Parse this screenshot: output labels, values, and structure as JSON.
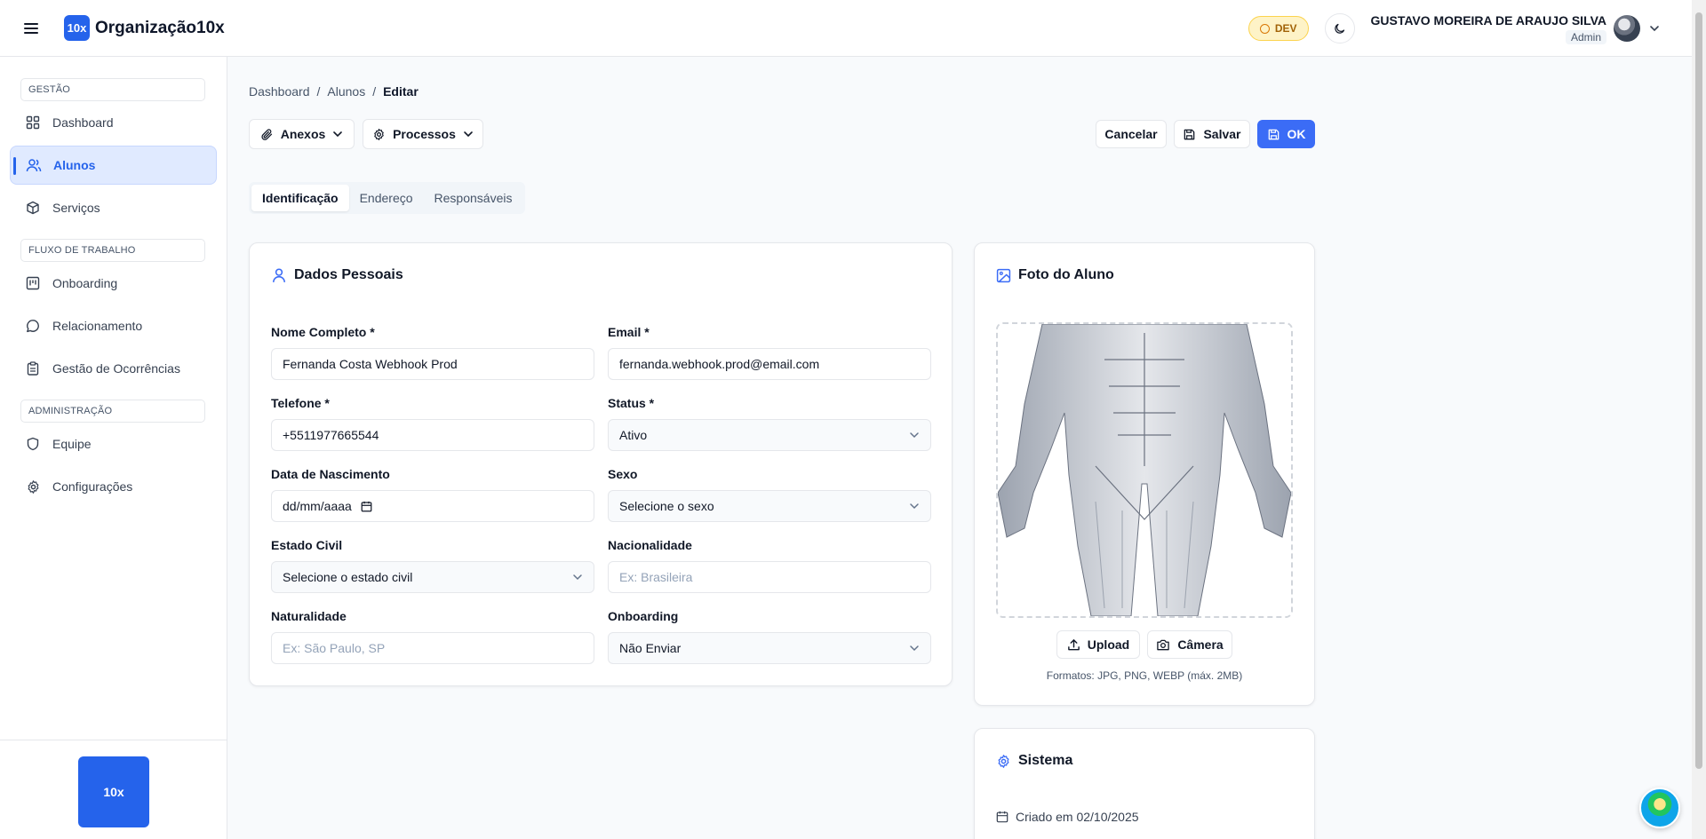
{
  "app": {
    "logo_text": "10x",
    "org_name": "Organização10x",
    "env_badge": "DEV",
    "user_name": "GUSTAVO MOREIRA DE ARAUJO SILVA",
    "user_role": "Admin"
  },
  "sidebar": {
    "sections": [
      {
        "label": "GESTÃO"
      },
      {
        "label": "FLUXO DE TRABALHO"
      },
      {
        "label": "ADMINISTRAÇÃO"
      }
    ],
    "items": [
      {
        "label": "Dashboard",
        "icon": "layout-grid-icon"
      },
      {
        "label": "Alunos",
        "icon": "users-icon",
        "active": true
      },
      {
        "label": "Serviços",
        "icon": "package-icon"
      },
      {
        "label": "Onboarding",
        "icon": "kanban-icon"
      },
      {
        "label": "Relacionamento",
        "icon": "message-circle-icon"
      },
      {
        "label": "Gestão de Ocorrências",
        "icon": "clipboard-icon"
      },
      {
        "label": "Equipe",
        "icon": "shield-icon"
      },
      {
        "label": "Configurações",
        "icon": "gear-icon"
      }
    ],
    "footer_logo": "10x"
  },
  "breadcrumb": {
    "items": [
      "Dashboard",
      "Alunos",
      "Editar"
    ],
    "separator": "/"
  },
  "toolbar": {
    "attachments_label": "Anexos",
    "processes_label": "Processos",
    "cancel_label": "Cancelar",
    "save_label": "Salvar",
    "ok_label": "OK"
  },
  "tabs": [
    {
      "label": "Identificação",
      "active": true
    },
    {
      "label": "Endereço"
    },
    {
      "label": "Responsáveis"
    }
  ],
  "personal": {
    "title": "Dados Pessoais",
    "full_name": {
      "label": "Nome Completo *",
      "value": "Fernanda Costa Webhook Prod"
    },
    "email": {
      "label": "Email *",
      "value": "fernanda.webhook.prod@email.com"
    },
    "phone": {
      "label": "Telefone *",
      "value": "+5511977665544"
    },
    "status": {
      "label": "Status *",
      "value": "Ativo"
    },
    "birth_date": {
      "label": "Data de Nascimento",
      "value": "dd/mm/aaaa"
    },
    "sex": {
      "label": "Sexo",
      "value": "Selecione o sexo"
    },
    "marital": {
      "label": "Estado Civil",
      "value": "Selecione o estado civil"
    },
    "nationality": {
      "label": "Nacionalidade",
      "placeholder": "Ex: Brasileira"
    },
    "birthplace": {
      "label": "Naturalidade",
      "placeholder": "Ex: São Paulo, SP"
    },
    "onboarding": {
      "label": "Onboarding",
      "value": "Não Enviar"
    }
  },
  "photo": {
    "title": "Foto do Aluno",
    "upload_label": "Upload",
    "camera_label": "Câmera",
    "formats": "Formatos: JPG, PNG, WEBP (máx. 2MB)"
  },
  "system": {
    "title": "Sistema",
    "created": "Criado em 02/10/2025"
  },
  "colors": {
    "accent": "#2563eb",
    "primary_button": "#3b6cf6",
    "dev_badge_bg": "#fef3c7"
  }
}
